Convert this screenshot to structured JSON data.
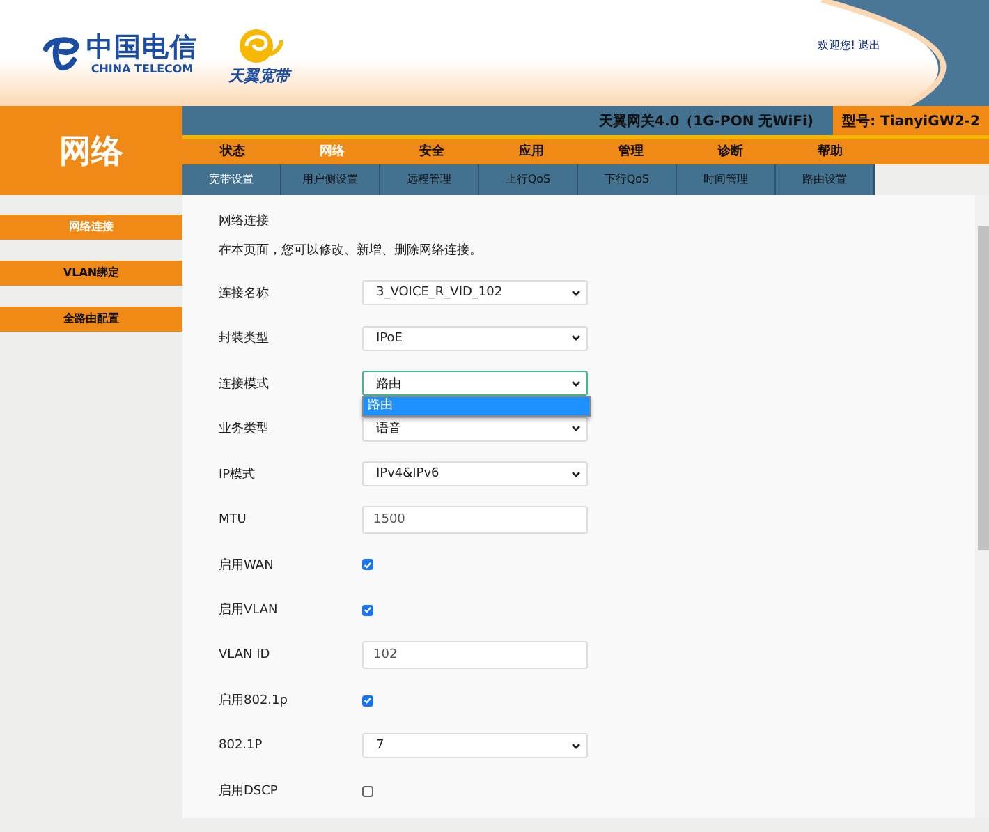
{
  "header": {
    "logo_cn": "中国电信",
    "logo_en": "CHINA TELECOM",
    "brand": "天翼宽带",
    "welcome": "欢迎您!",
    "logout": "退出"
  },
  "section_title": "网络",
  "gateway": {
    "title": "天翼网关4.0（1G-PON 无WiFi)",
    "model": "型号: TianyiGW2-2"
  },
  "main_nav": [
    {
      "label": "状态",
      "selected": false
    },
    {
      "label": "网络",
      "selected": true
    },
    {
      "label": "安全",
      "selected": false
    },
    {
      "label": "应用",
      "selected": false
    },
    {
      "label": "管理",
      "selected": false
    },
    {
      "label": "诊断",
      "selected": false
    },
    {
      "label": "帮助",
      "selected": false
    }
  ],
  "sub_nav": [
    {
      "label": "宽带设置",
      "selected": true
    },
    {
      "label": "用户侧设置",
      "selected": false
    },
    {
      "label": "远程管理",
      "selected": false
    },
    {
      "label": "上行QoS",
      "selected": false
    },
    {
      "label": "下行QoS",
      "selected": false
    },
    {
      "label": "时间管理",
      "selected": false
    },
    {
      "label": "路由设置",
      "selected": false
    }
  ],
  "sidebar": [
    {
      "label": "网络连接",
      "selected": true
    },
    {
      "label": "VLAN绑定",
      "selected": false
    },
    {
      "label": "全路由配置",
      "selected": false
    }
  ],
  "page_title": "网络连接",
  "description": "在本页面，您可以修改、新增、删除网络连接。",
  "fields": [
    {
      "kind": "select",
      "label": "连接名称",
      "value": "3_VOICE_R_VID_102",
      "focused": false
    },
    {
      "kind": "select",
      "label": "封装类型",
      "value": "IPoE",
      "focused": false
    },
    {
      "kind": "select",
      "label": "连接模式",
      "value": "路由",
      "focused": true,
      "options": [
        {
          "label": "路由",
          "selected": true
        }
      ]
    },
    {
      "kind": "select",
      "label": "业务类型",
      "value": "语音",
      "focused": false
    },
    {
      "kind": "select",
      "label": "IP模式",
      "value": "IPv4&IPv6",
      "focused": false
    },
    {
      "kind": "text",
      "label": "MTU",
      "value": "1500"
    },
    {
      "kind": "checkbox",
      "label": "启用WAN",
      "checked": true
    },
    {
      "kind": "checkbox",
      "label": "启用VLAN",
      "checked": true
    },
    {
      "kind": "text",
      "label": "VLAN ID",
      "value": "102"
    },
    {
      "kind": "checkbox",
      "label": "启用802.1p",
      "checked": true
    },
    {
      "kind": "select",
      "label": "802.1P",
      "value": "7",
      "focused": false
    },
    {
      "kind": "checkbox",
      "label": "启用DSCP",
      "checked": false
    }
  ]
}
